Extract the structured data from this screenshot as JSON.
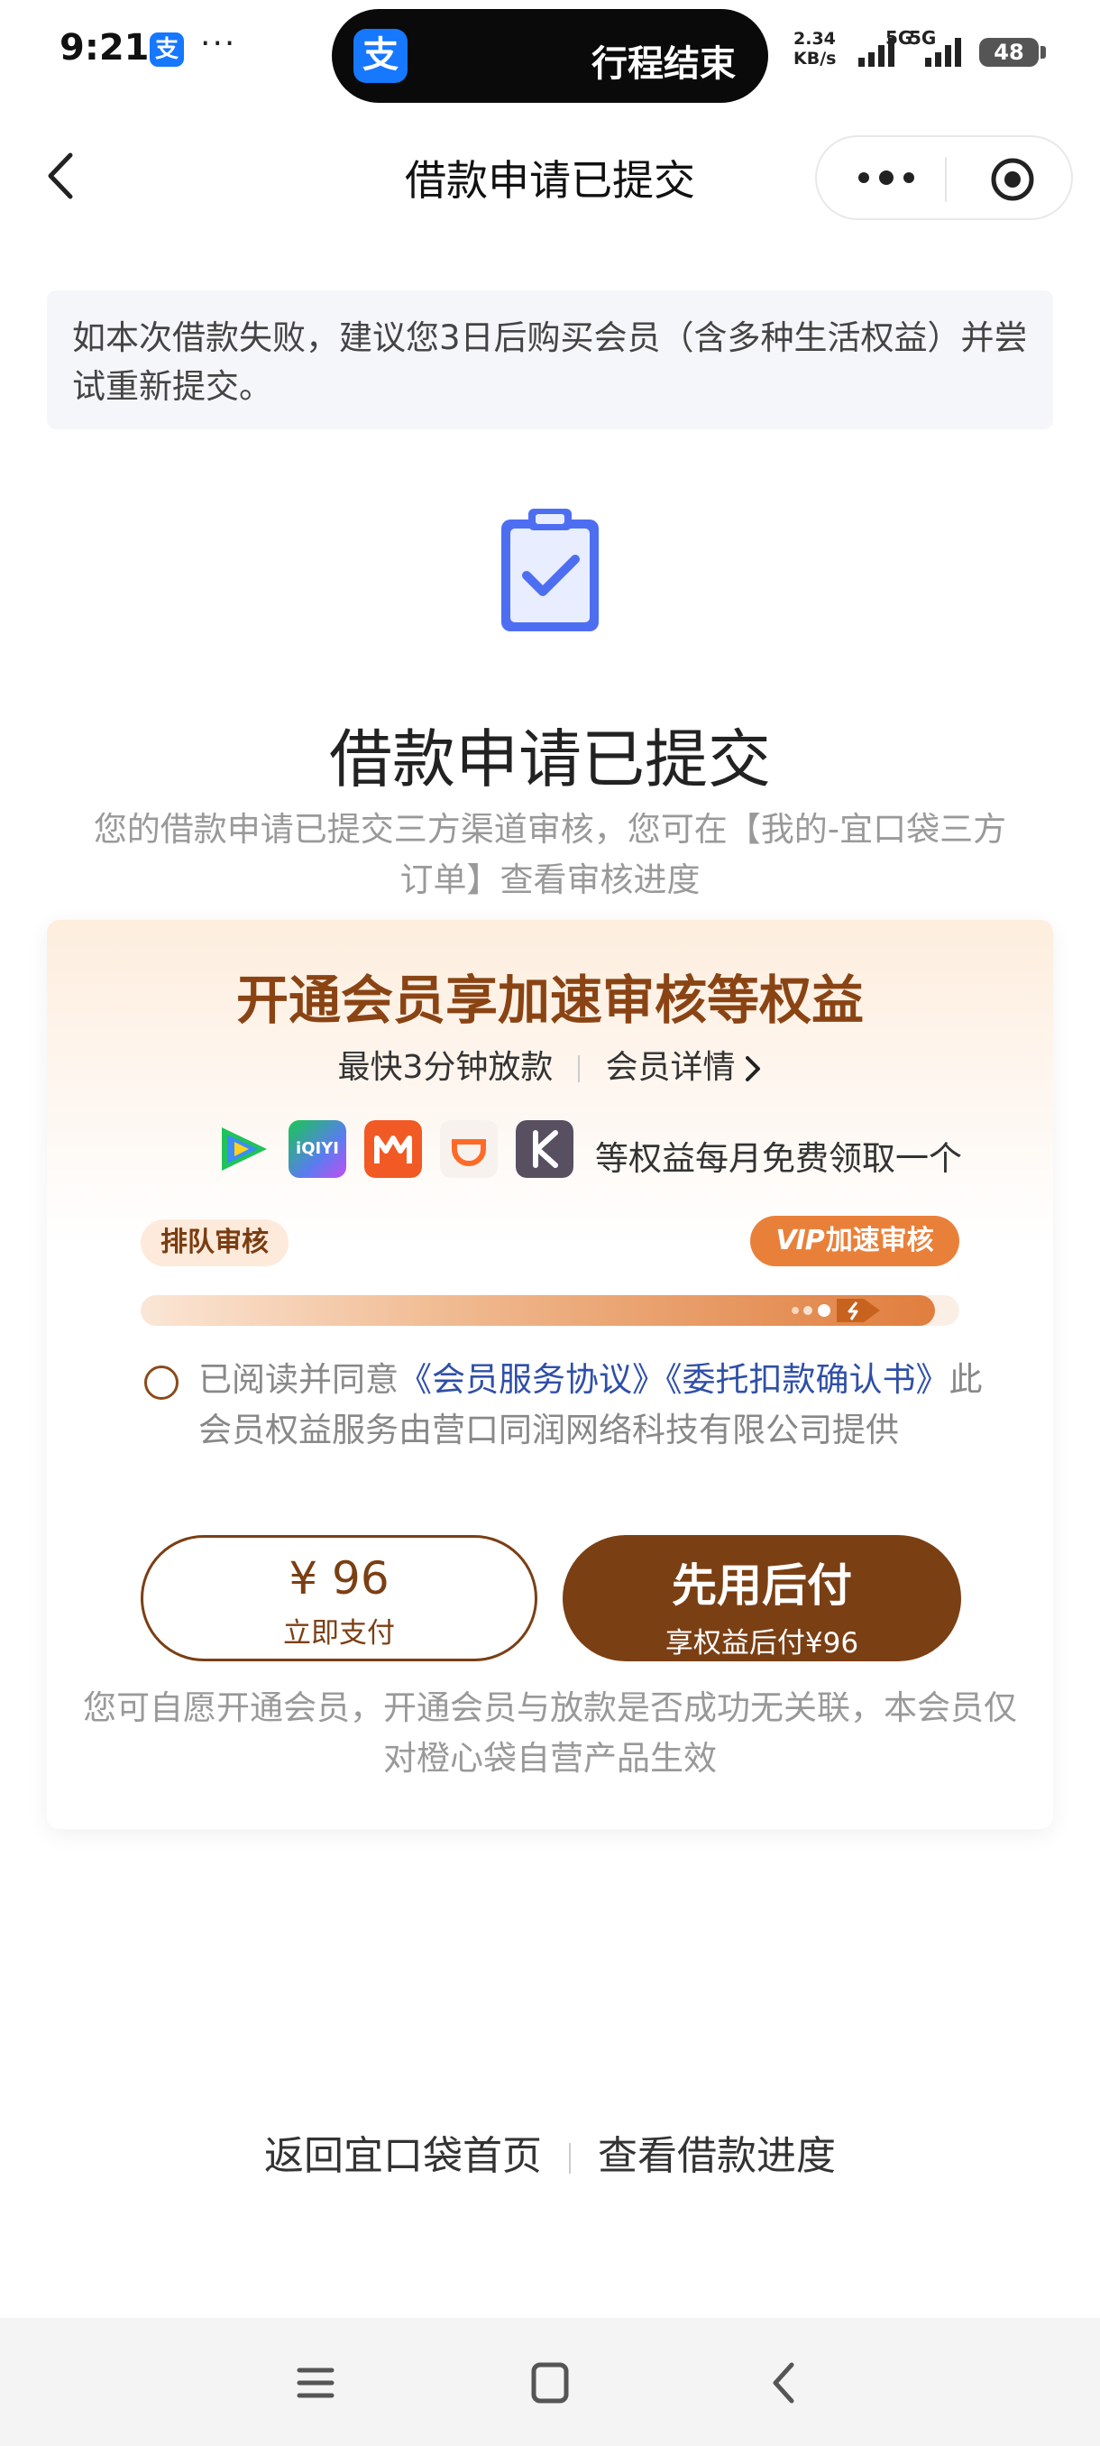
{
  "status_bar": {
    "time": "9:21",
    "app_icon_glyph": "支",
    "more": "···",
    "island_app_glyph": "支",
    "island_text": "行程结束",
    "net_speed_value": "2.34",
    "net_speed_unit": "KB/s",
    "sim1_label": "5G",
    "sim2_label": "5G",
    "battery": "48"
  },
  "nav": {
    "title": "借款申请已提交"
  },
  "notice": {
    "text": "如本次借款失败，建议您3日后购买会员（含多种生活权益）并尝试重新提交。"
  },
  "result": {
    "title": "借款申请已提交",
    "description": "您的借款申请已提交三方渠道审核，您可在【我的-宜口袋三方订单】查看审核进度"
  },
  "member_card": {
    "title": "开通会员享加速审核等权益",
    "fast_release": "最快3分钟放款",
    "details_link": "会员详情",
    "benefit_icons": [
      "tencent-video-icon",
      "iqiyi-icon",
      "mango-tv-icon",
      "didi-icon",
      "keep-icon"
    ],
    "iqiyi_logo_text": "iQIYI",
    "benefits_text": "等权益每月免费领取一个",
    "queue_label": "排队审核",
    "vip_badge": "VIP",
    "vip_label": "加速审核",
    "progress": 0.97,
    "agreement_prefix": "已阅读并同意",
    "agreement_link1": "《会员服务协议》",
    "agreement_link2": "《委托扣款确认书》",
    "agreement_suffix": "此会员权益服务由营口同润网络科技有限公司提供",
    "pay_amount": "¥ 96",
    "pay_label": "立即支付",
    "later_title": "先用后付",
    "later_sub": "享权益后付¥96",
    "disclaimer": "您可自愿开通会员，开通会员与放款是否成功无关联，本会员仅对橙心袋自营产品生效",
    "colors": {
      "brand_brown": "#7b3f14",
      "title_brown": "#8a4414",
      "accent_orange": "#e9803a",
      "link_blue": "#2f4fa7"
    }
  },
  "footer": {
    "home_link": "返回宜口袋首页",
    "progress_link": "查看借款进度"
  }
}
